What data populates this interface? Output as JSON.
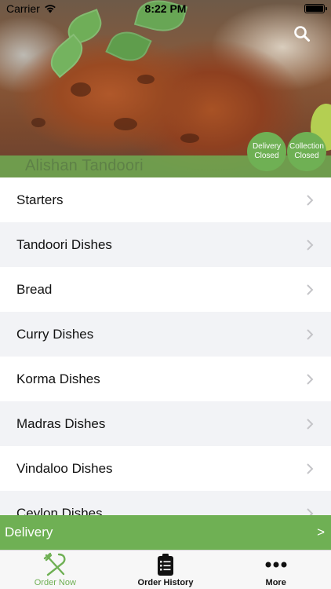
{
  "status_bar": {
    "carrier": "Carrier",
    "time": "8:22 PM",
    "battery_level": 1.0
  },
  "header": {
    "restaurant_name": "Alishan Tandoori",
    "search_icon": "search-icon",
    "badges": {
      "delivery": {
        "line1": "Delivery",
        "line2": "Closed"
      },
      "collection": {
        "line1": "Collection",
        "line2": "Closed"
      }
    }
  },
  "menu": {
    "items": [
      {
        "label": "Starters"
      },
      {
        "label": "Tandoori Dishes"
      },
      {
        "label": "Bread"
      },
      {
        "label": "Curry Dishes"
      },
      {
        "label": "Korma Dishes"
      },
      {
        "label": "Madras Dishes"
      },
      {
        "label": "Vindaloo Dishes"
      },
      {
        "label": "Ceylon Dishes"
      }
    ]
  },
  "delivery_bar": {
    "label": "Delivery",
    "arrow": ">"
  },
  "tabs": [
    {
      "label": "Order Now",
      "icon": "fork-knife-icon",
      "active": true
    },
    {
      "label": "Order History",
      "icon": "clipboard-list-icon",
      "active": false
    },
    {
      "label": "More",
      "icon": "more-dots-icon",
      "active": false
    }
  ],
  "colors": {
    "accent": "#6fb054",
    "row_alt": "#f2f3f6"
  }
}
